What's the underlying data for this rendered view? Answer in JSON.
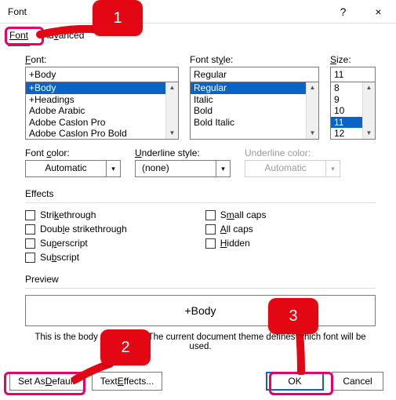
{
  "titlebar": {
    "title": "Font",
    "help": "?",
    "close": "×"
  },
  "tabs": {
    "font": "Font",
    "advanced": "Advanced"
  },
  "labels": {
    "font": "Font:",
    "style": "Font style:",
    "size": "Size:",
    "font_color": "Font color:",
    "underline_style": "Underline style:",
    "underline_color": "Underline color:",
    "effects": "Effects",
    "preview": "Preview"
  },
  "font_input": "+Body",
  "font_list": [
    "+Body",
    "+Headings",
    "Adobe Arabic",
    "Adobe Caslon Pro",
    "Adobe Caslon Pro Bold"
  ],
  "style_input": "Regular",
  "style_list": [
    "Regular",
    "Italic",
    "Bold",
    "Bold Italic"
  ],
  "size_input": "11",
  "size_list": [
    "8",
    "9",
    "10",
    "11",
    "12"
  ],
  "font_color_value": "Automatic",
  "underline_style_value": "(none)",
  "underline_color_value": "Automatic",
  "effects_left": [
    {
      "label": "Strikethrough",
      "acc": "k"
    },
    {
      "label": "Double strikethrough",
      "acc": "l"
    },
    {
      "label": "Superscript",
      "acc": "p"
    },
    {
      "label": "Subscript",
      "acc": "b"
    }
  ],
  "effects_right": [
    {
      "label": "Small caps",
      "acc": "m"
    },
    {
      "label": "All caps",
      "acc": "A"
    },
    {
      "label": "Hidden",
      "acc": "H"
    }
  ],
  "preview_text": "+Body",
  "hint": "This is the body theme font. The current document theme defines which font will be used.",
  "buttons": {
    "set_default": "Set As Default",
    "text_effects": "Text Effects...",
    "ok": "OK",
    "cancel": "Cancel"
  },
  "callouts": {
    "c1": "1",
    "c2": "2",
    "c3": "3"
  }
}
